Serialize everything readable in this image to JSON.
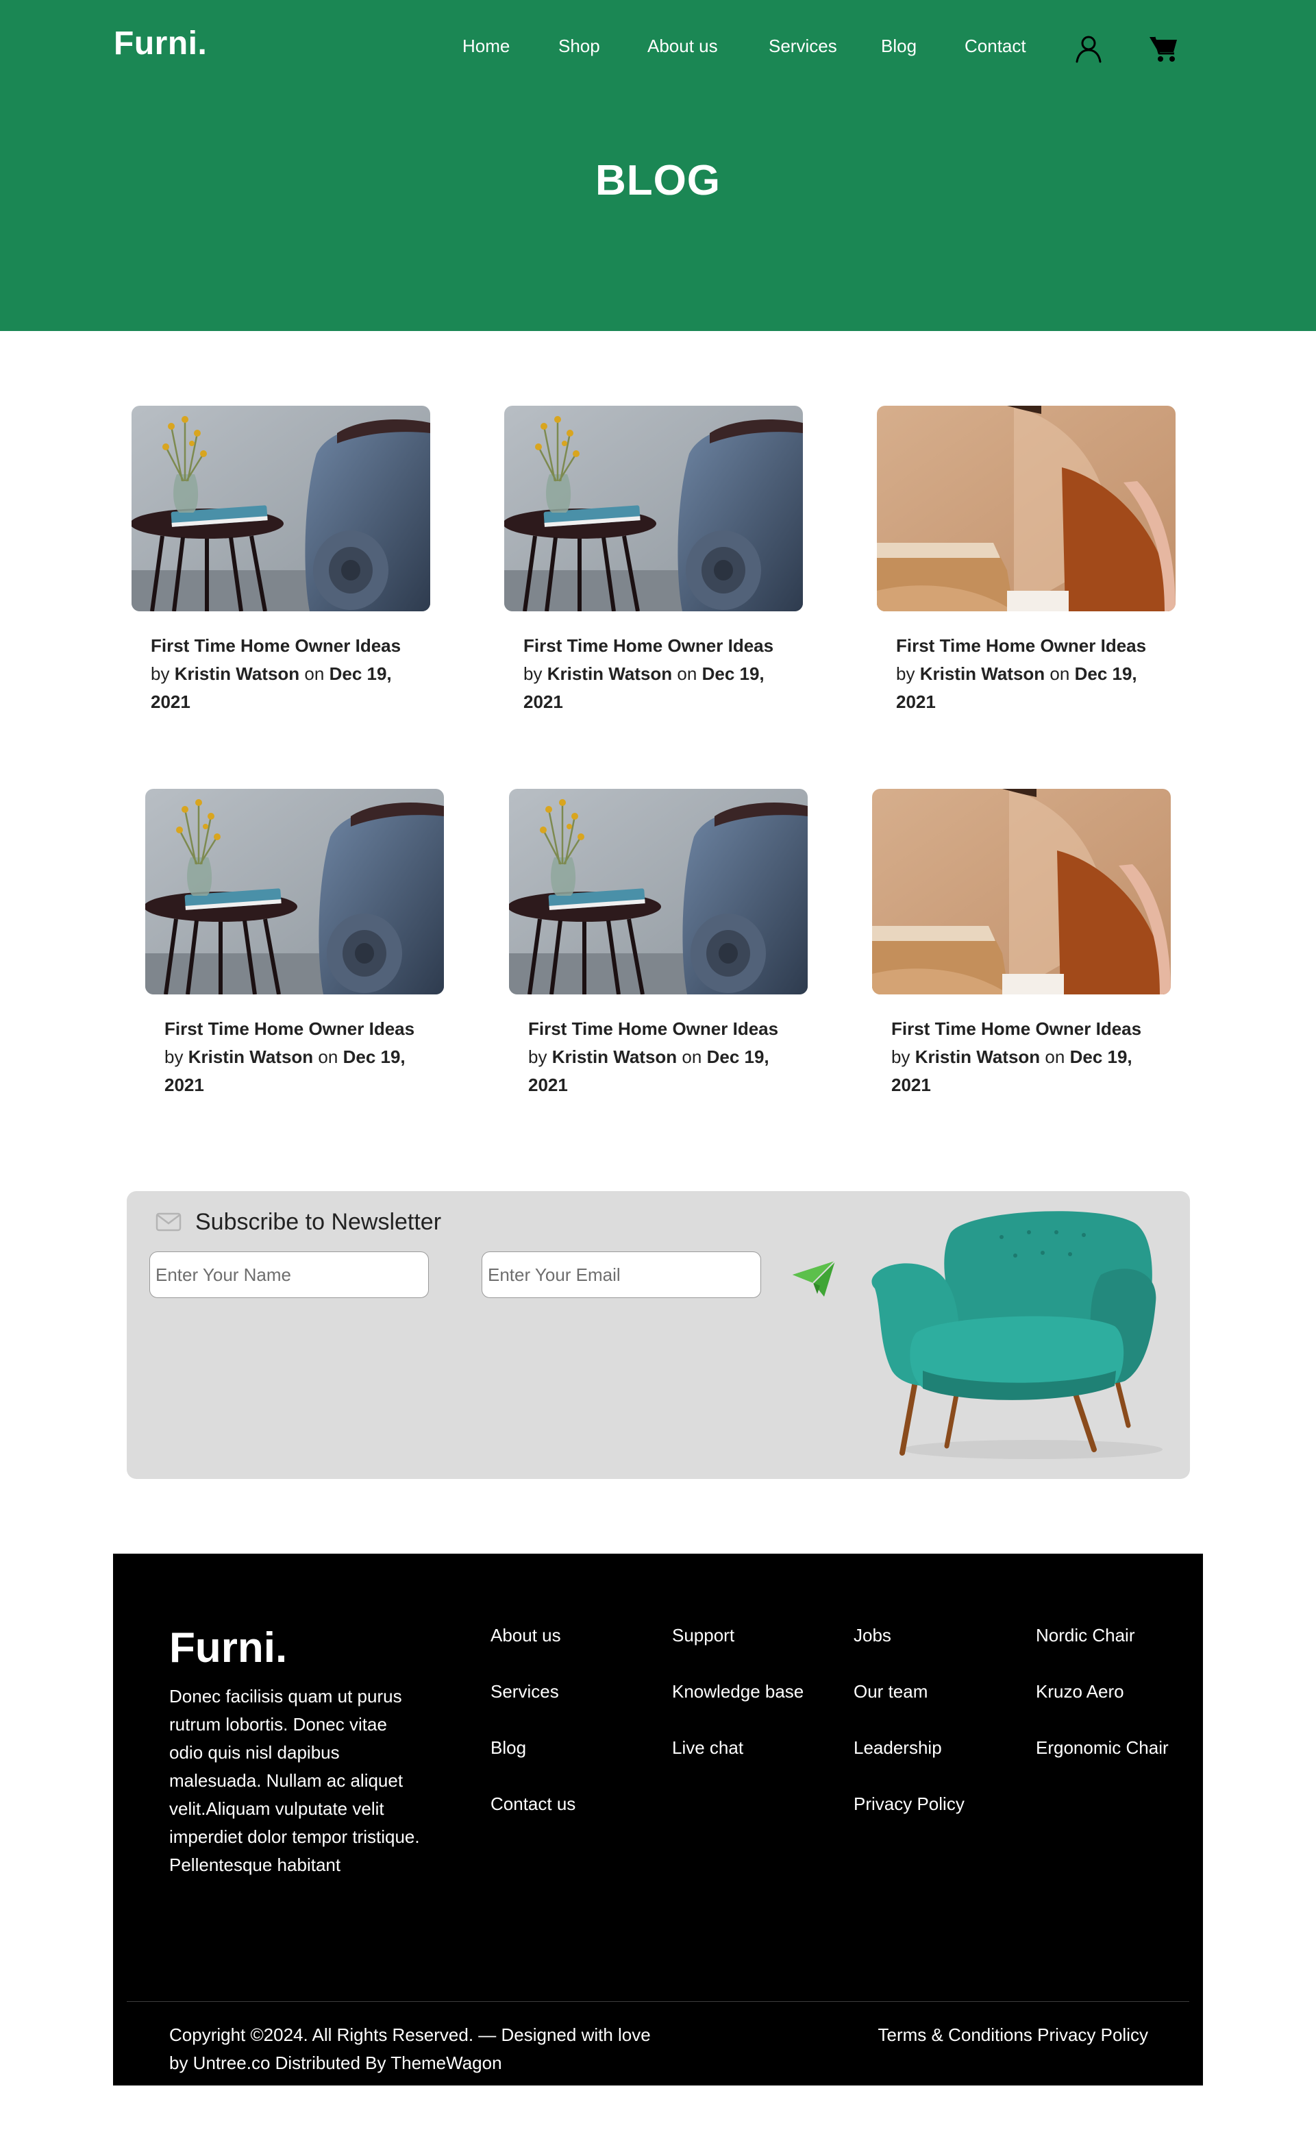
{
  "header": {
    "brand": "Furni.",
    "nav": [
      {
        "label": "Home"
      },
      {
        "label": "Shop"
      },
      {
        "label": "About us"
      },
      {
        "label": "Services"
      },
      {
        "label": "Blog"
      },
      {
        "label": "Contact"
      }
    ],
    "icons": [
      "user-icon",
      "cart-icon"
    ]
  },
  "hero": {
    "title": "BLOG"
  },
  "posts": [
    {
      "title": "First Time Home Owner Ideas",
      "by": "by",
      "author": "Kristin Watson",
      "on": "on",
      "date": "Dec 19, 2021",
      "image": "side-table-sofa"
    },
    {
      "title": "First Time Home Owner Ideas",
      "by": "by",
      "author": "Kristin Watson",
      "on": "on",
      "date": "Dec 19, 2021",
      "image": "side-table-sofa"
    },
    {
      "title": "First Time Home Owner Ideas",
      "by": "by",
      "author": "Kristin Watson",
      "on": "on",
      "date": "Dec 19, 2021",
      "image": "terracotta-shapes"
    },
    {
      "title": "First Time Home Owner Ideas",
      "by": "by",
      "author": "Kristin Watson",
      "on": "on",
      "date": "Dec 19, 2021",
      "image": "side-table-sofa"
    },
    {
      "title": "First Time Home Owner Ideas",
      "by": "by",
      "author": "Kristin Watson",
      "on": "on",
      "date": "Dec 19, 2021",
      "image": "side-table-sofa"
    },
    {
      "title": "First Time Home Owner Ideas",
      "by": "by",
      "author": "Kristin Watson",
      "on": "on",
      "date": "Dec 19, 2021",
      "image": "terracotta-shapes"
    }
  ],
  "newsletter": {
    "title": "Subscribe to Newsletter",
    "name_placeholder": "Enter Your Name",
    "email_placeholder": "Enter Your Email",
    "icon": "paper-plane-icon"
  },
  "footer": {
    "brand": "Furni.",
    "description": "Donec facilisis quam ut purus rutrum lobortis. Donec vitae odio quis nisl dapibus malesuada. Nullam ac aliquet velit.Aliquam vulputate velit imperdiet dolor tempor tristique. Pellentesque habitant",
    "columns": [
      [
        "About us",
        "Services",
        "Blog",
        "Contact us"
      ],
      [
        "Support",
        "Knowledge base",
        "Live chat"
      ],
      [
        "Jobs",
        "Our team",
        "Leadership",
        "Privacy Policy"
      ],
      [
        "Nordic Chair",
        "Kruzo Aero",
        "Ergonomic Chair"
      ]
    ],
    "copyright": "Copyright ©2024. All Rights Reserved. — Designed with love by Untree.co Distributed By ThemeWagon",
    "terms": "Terms & Conditions",
    "privacy": "Privacy Policy"
  },
  "colors": {
    "brand_green": "#1b8754",
    "newsletter_bg": "#dcdcdc",
    "footer_bg": "#000000",
    "chair_teal": "#2a9d8f"
  }
}
